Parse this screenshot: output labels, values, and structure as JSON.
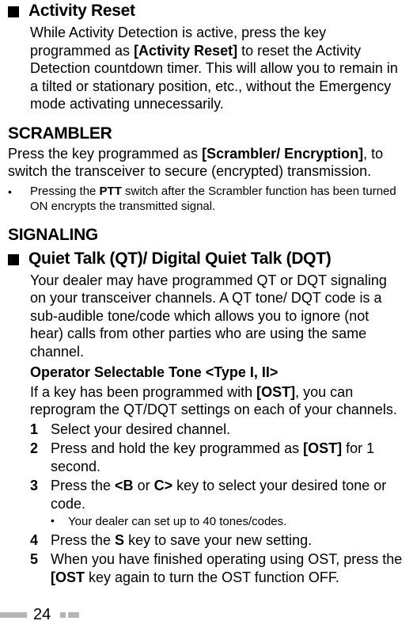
{
  "sec1": {
    "title": "Activity Reset",
    "body_parts": [
      "While Activity Detection is active, press the key programmed as ",
      "[Activity Reset]",
      " to reset the Activity Detection countdown timer.  This will allow you to remain in a tilted or stationary position, etc., without the Emergency mode activating unnecessarily."
    ]
  },
  "scrambler": {
    "heading": "SCRAMBLER",
    "body_parts": [
      "Press the key programmed as ",
      "[Scrambler/ Encryption]",
      ", to switch the transceiver to secure (encrypted) transmission."
    ],
    "note_bullet": "•",
    "note_parts": [
      "Pressing the ",
      "PTT",
      " switch after the Scrambler function has been turned ON encrypts the transmitted signal."
    ]
  },
  "signaling": {
    "heading": "SIGNALING",
    "sub_title": "Quiet Talk (QT)/ Digital Quiet Talk (DQT)",
    "intro": "Your dealer may have programmed QT or DQT signaling on your transceiver channels.  A QT tone/ DQT code  is a sub-audible tone/code which allows you to ignore (not hear) calls from other parties who are using the same channel.",
    "ost_heading": "Operator Selectable Tone <Type I, II>",
    "ost_intro_parts": [
      "If a key has been programmed with ",
      "[OST]",
      ", you can reprogram the QT/DQT settings on each of your channels."
    ],
    "steps": [
      {
        "n": "1",
        "parts": [
          "Select your desired channel."
        ]
      },
      {
        "n": "2",
        "parts": [
          "Press and hold the key programmed as ",
          "[OST]",
          " for 1 second."
        ]
      },
      {
        "n": "3",
        "parts": [
          "Press the ",
          "<B",
          " or ",
          "C>",
          " key to select your desired tone or code."
        ],
        "sub_bullet": "•",
        "sub_text": "Your dealer can set up to 40 tones/codes."
      },
      {
        "n": "4",
        "parts": [
          "Press the ",
          "S",
          " key to save your new setting."
        ]
      },
      {
        "n": "5",
        "parts": [
          "When you have finished operating using OST, press the ",
          "[OST",
          " key again to turn the OST function OFF."
        ]
      }
    ]
  },
  "page_number": "24"
}
